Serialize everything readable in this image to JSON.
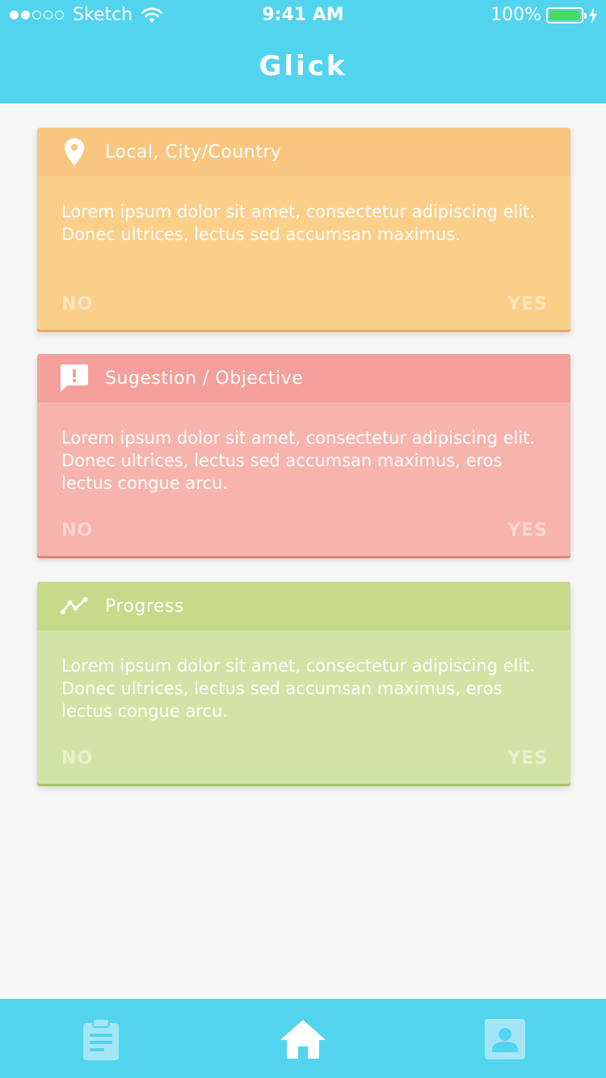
{
  "status_bar": {
    "carrier": "Sketch",
    "signal_dots_filled": 2,
    "signal_dots_total": 5,
    "time": "9:41 AM",
    "battery_percent": "100%"
  },
  "header": {
    "title": "Glick"
  },
  "cards": [
    {
      "title": "Local, City/Country",
      "icon": "location-pin-icon",
      "text": "Lorem ipsum dolor sit amet, consectetur adipiscing elit. Donec ultrices, lectus sed accumsan maximus.",
      "no_label": "NO",
      "yes_label": "YES"
    },
    {
      "title": "Sugestion / Objective",
      "icon": "feedback-icon",
      "text": "Lorem ipsum dolor sit amet, consectetur adipiscing elit. Donec ultrices, lectus sed accumsan maximus, eros lectus congue arcu.",
      "no_label": "NO",
      "yes_label": "YES"
    },
    {
      "title": "Progress",
      "icon": "trend-line-icon",
      "text": "Lorem ipsum dolor sit amet, consectetur adipiscing elit. Donec ultrices, lectus sed accumsan maximus, eros lectus congue arcu.",
      "no_label": "NO",
      "yes_label": "YES"
    }
  ],
  "tab_bar": {
    "tabs": [
      {
        "icon": "clipboard-icon",
        "active": false
      },
      {
        "icon": "home-icon",
        "active": true
      },
      {
        "icon": "contact-icon",
        "active": false
      }
    ]
  },
  "colors": {
    "brand": "#52d4ef",
    "card_orange": "#fbcf8a",
    "card_red": "#f7b4ac",
    "card_green": "#d2e3a5"
  }
}
